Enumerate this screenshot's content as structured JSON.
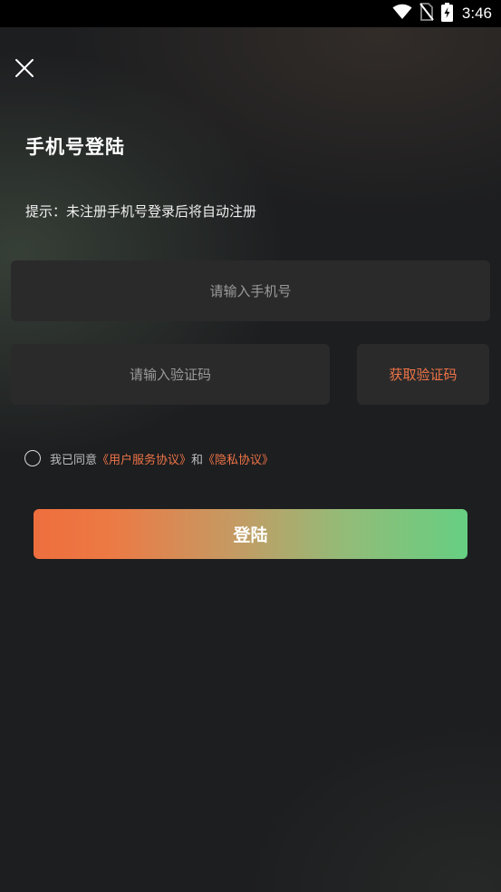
{
  "status_bar": {
    "time": "3:46",
    "icons": [
      "wifi-icon",
      "no-sim-icon",
      "battery-charging-icon"
    ]
  },
  "header": {
    "close_icon": "close-icon"
  },
  "login": {
    "title": "手机号登陆",
    "hint": "提示：未注册手机号登录后将自动注册",
    "phone_placeholder": "请输入手机号",
    "phone_value": "",
    "code_placeholder": "请输入验证码",
    "code_value": "",
    "get_code_label": "获取验证码",
    "agreement": {
      "checked": false,
      "prefix": "我已同意",
      "user_agreement": "《用户服务协议》",
      "conjunction": "和",
      "privacy_policy": "《隐私协议》"
    },
    "submit_label": "登陆"
  },
  "colors": {
    "background": "#1d1e20",
    "field_background": "#2a2a2b",
    "accent_orange": "#ee7446",
    "button_gradient_start": "#ee6e3e",
    "button_gradient_end": "#66cf82"
  }
}
